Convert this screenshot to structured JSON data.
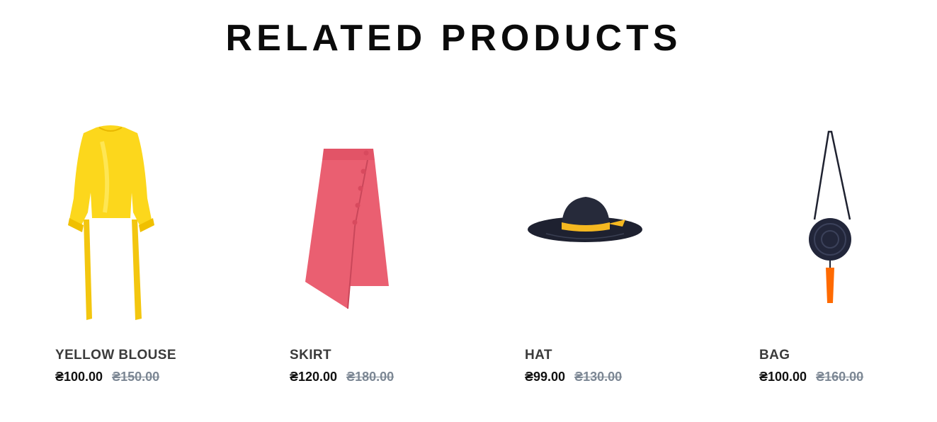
{
  "section": {
    "title": "RELATED PRODUCTS"
  },
  "products": [
    {
      "name": "YELLOW BLOUSE",
      "price": "₴100.00",
      "old_price": "₴150.00",
      "image_color": "#f7d21b",
      "icon": "yellow-blouse-image"
    },
    {
      "name": "SKIRT",
      "price": "₴120.00",
      "old_price": "₴180.00",
      "image_color": "#e45a6c",
      "icon": "skirt-image"
    },
    {
      "name": "HAT",
      "price": "₴99.00",
      "old_price": "₴130.00",
      "image_color": "#1c1f2a",
      "icon": "hat-image"
    },
    {
      "name": "BAG",
      "price": "₴100.00",
      "old_price": "₴160.00",
      "image_color": "#1f2230",
      "icon": "bag-image"
    }
  ],
  "colors": {
    "text": "#111111",
    "name": "#3b3b3b",
    "old_price": "#7c8794",
    "accent_orange": "#ff6a00",
    "hat_band": "#f5b820"
  }
}
